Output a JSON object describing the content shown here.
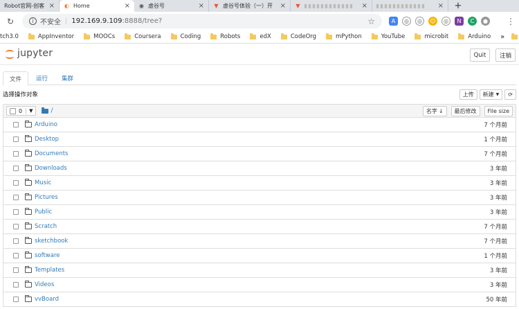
{
  "browser": {
    "tabs": [
      {
        "title": "Robot官网-创客",
        "icon": "page-icon"
      },
      {
        "title": "Home",
        "icon": "jupyter-icon",
        "active": true
      },
      {
        "title": "虚谷号",
        "icon": "globe-icon"
      },
      {
        "title": "虚谷号体验（一）开",
        "icon": "fox-icon"
      },
      {
        "title": "",
        "icon": "fox-icon"
      },
      {
        "title": "",
        "icon": "page-icon"
      }
    ],
    "new_tab": "+",
    "close": "×",
    "address": {
      "security": "不安全",
      "host": "192.169.9.109",
      "path": ":8888/tree?"
    },
    "bookmarks": [
      "tch3.0",
      "AppInventor",
      "MOOCs",
      "Coursera",
      "Coding",
      "Robots",
      "edX",
      "CodeOrg",
      "mPython",
      "YouTube",
      "microbit",
      "Arduino"
    ],
    "bookmarks_more": "»"
  },
  "jupyter": {
    "logo_text": "jupyter",
    "quit_label": "Quit",
    "logout_label": "注销",
    "tabs": [
      "文件",
      "运行",
      "集群"
    ],
    "toolbar_hint": "选择操作对象",
    "upload_label": "上传",
    "new_label": "新建",
    "refresh_icon": "⟳",
    "select_count": "0",
    "breadcrumb": "/",
    "sort_name_label": "名字",
    "sort_modified_label": "最后修改",
    "sort_size_label": "File size",
    "files": [
      {
        "name": "Arduino",
        "modified": "7 个月前"
      },
      {
        "name": "Desktop",
        "modified": "1 个月前"
      },
      {
        "name": "Documents",
        "modified": "7 个月前"
      },
      {
        "name": "Downloads",
        "modified": "3 年前"
      },
      {
        "name": "Music",
        "modified": "3 年前"
      },
      {
        "name": "Pictures",
        "modified": "3 年前"
      },
      {
        "name": "Public",
        "modified": "3 年前"
      },
      {
        "name": "Scratch",
        "modified": "7 个月前"
      },
      {
        "name": "sketchbook",
        "modified": "7 个月前"
      },
      {
        "name": "software",
        "modified": "1 个月前"
      },
      {
        "name": "Templates",
        "modified": "3 年前"
      },
      {
        "name": "Videos",
        "modified": "3 年前"
      },
      {
        "name": "vvBoard",
        "modified": "50 年前"
      }
    ]
  }
}
